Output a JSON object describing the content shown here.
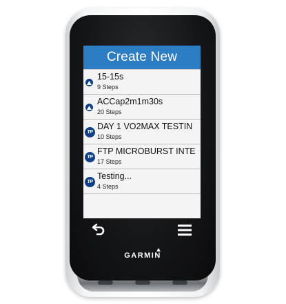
{
  "screen": {
    "title": "Create New",
    "workouts": [
      {
        "title": "15-15s",
        "steps": "9 Steps",
        "icon": "garmin-triangle-icon"
      },
      {
        "title": "ACCap2m1m30s",
        "steps": "20 Steps",
        "icon": "garmin-triangle-icon"
      },
      {
        "title": "DAY 1 VO2MAX TESTIN",
        "steps": "10 Steps",
        "icon": "trainingpeaks-icon",
        "badge": "TP"
      },
      {
        "title": "FTP MICROBURST INTE",
        "steps": "17 Steps",
        "icon": "trainingpeaks-icon",
        "badge": "TP"
      },
      {
        "title": "Testing...",
        "steps": "4 Steps",
        "icon": "trainingpeaks-icon",
        "badge": "TP"
      }
    ]
  },
  "device": {
    "brand": "GARMIN"
  },
  "colors": {
    "header": "#2d7dc5",
    "icon": "#0f3f86",
    "bezel": "#141517"
  }
}
